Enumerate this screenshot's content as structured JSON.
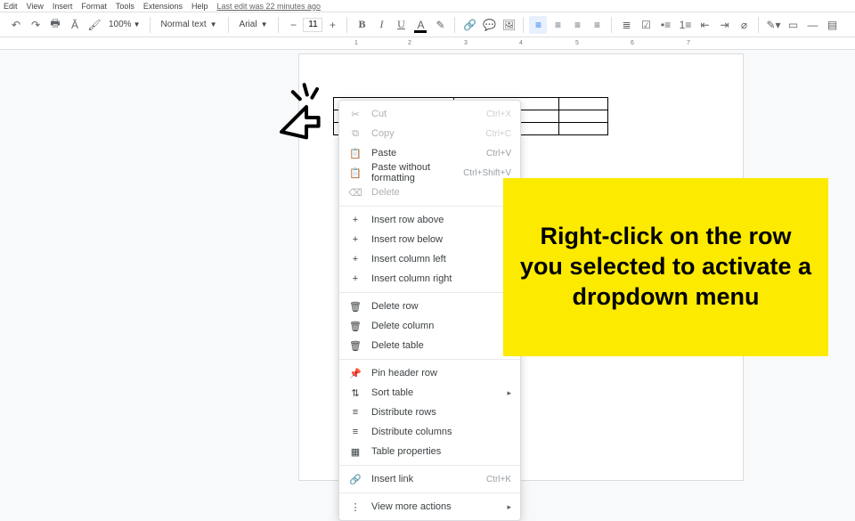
{
  "menubar": {
    "items": [
      "Edit",
      "View",
      "Insert",
      "Format",
      "Tools",
      "Extensions",
      "Help"
    ],
    "last_edit": "Last edit was 22 minutes ago"
  },
  "toolbar": {
    "zoom": "100%",
    "style": "Normal text",
    "font": "Arial",
    "size": "11"
  },
  "ruler": {
    "ticks": [
      "1",
      "2",
      "3",
      "4",
      "5",
      "6",
      "7"
    ]
  },
  "context_menu": {
    "groups": [
      [
        {
          "icon": "cut",
          "label": "Cut",
          "shortcut": "Ctrl+X",
          "disabled": true
        },
        {
          "icon": "copy",
          "label": "Copy",
          "shortcut": "Ctrl+C",
          "disabled": true
        },
        {
          "icon": "paste",
          "label": "Paste",
          "shortcut": "Ctrl+V",
          "disabled": false
        },
        {
          "icon": "paste-plain",
          "label": "Paste without formatting",
          "shortcut": "Ctrl+Shift+V",
          "disabled": false
        },
        {
          "icon": "delete",
          "label": "Delete",
          "shortcut": "",
          "disabled": true
        }
      ],
      [
        {
          "icon": "plus",
          "label": "Insert row above",
          "shortcut": "",
          "disabled": false
        },
        {
          "icon": "plus",
          "label": "Insert row below",
          "shortcut": "",
          "disabled": false
        },
        {
          "icon": "plus",
          "label": "Insert column left",
          "shortcut": "",
          "disabled": false
        },
        {
          "icon": "plus",
          "label": "Insert column right",
          "shortcut": "",
          "disabled": false
        }
      ],
      [
        {
          "icon": "trash",
          "label": "Delete row",
          "shortcut": "",
          "disabled": false
        },
        {
          "icon": "trash",
          "label": "Delete column",
          "shortcut": "",
          "disabled": false
        },
        {
          "icon": "trash",
          "label": "Delete table",
          "shortcut": "",
          "disabled": false
        }
      ],
      [
        {
          "icon": "pin",
          "label": "Pin header row",
          "shortcut": "",
          "disabled": false
        },
        {
          "icon": "sort",
          "label": "Sort table",
          "shortcut": "",
          "submenu": true,
          "disabled": false
        },
        {
          "icon": "dist-rows",
          "label": "Distribute rows",
          "shortcut": "",
          "disabled": false
        },
        {
          "icon": "dist-cols",
          "label": "Distribute columns",
          "shortcut": "",
          "disabled": false
        },
        {
          "icon": "table-props",
          "label": "Table properties",
          "shortcut": "",
          "disabled": false
        }
      ],
      [
        {
          "icon": "link",
          "label": "Insert link",
          "shortcut": "Ctrl+K",
          "disabled": false
        }
      ],
      [
        {
          "icon": "more",
          "label": "View more actions",
          "shortcut": "",
          "submenu": true,
          "disabled": false
        }
      ]
    ]
  },
  "callout": {
    "text": "Right-click on the row you selected to activate a dropdown menu"
  },
  "icons": {
    "cut": "✂",
    "copy": "⧉",
    "paste": "📋",
    "paste-plain": "📋",
    "delete": "⌫",
    "plus": "+",
    "trash": "🗑",
    "pin": "📌",
    "sort": "⇅",
    "dist-rows": "≡",
    "dist-cols": "≡",
    "table-props": "▦",
    "link": "🔗",
    "more": "⋮"
  }
}
